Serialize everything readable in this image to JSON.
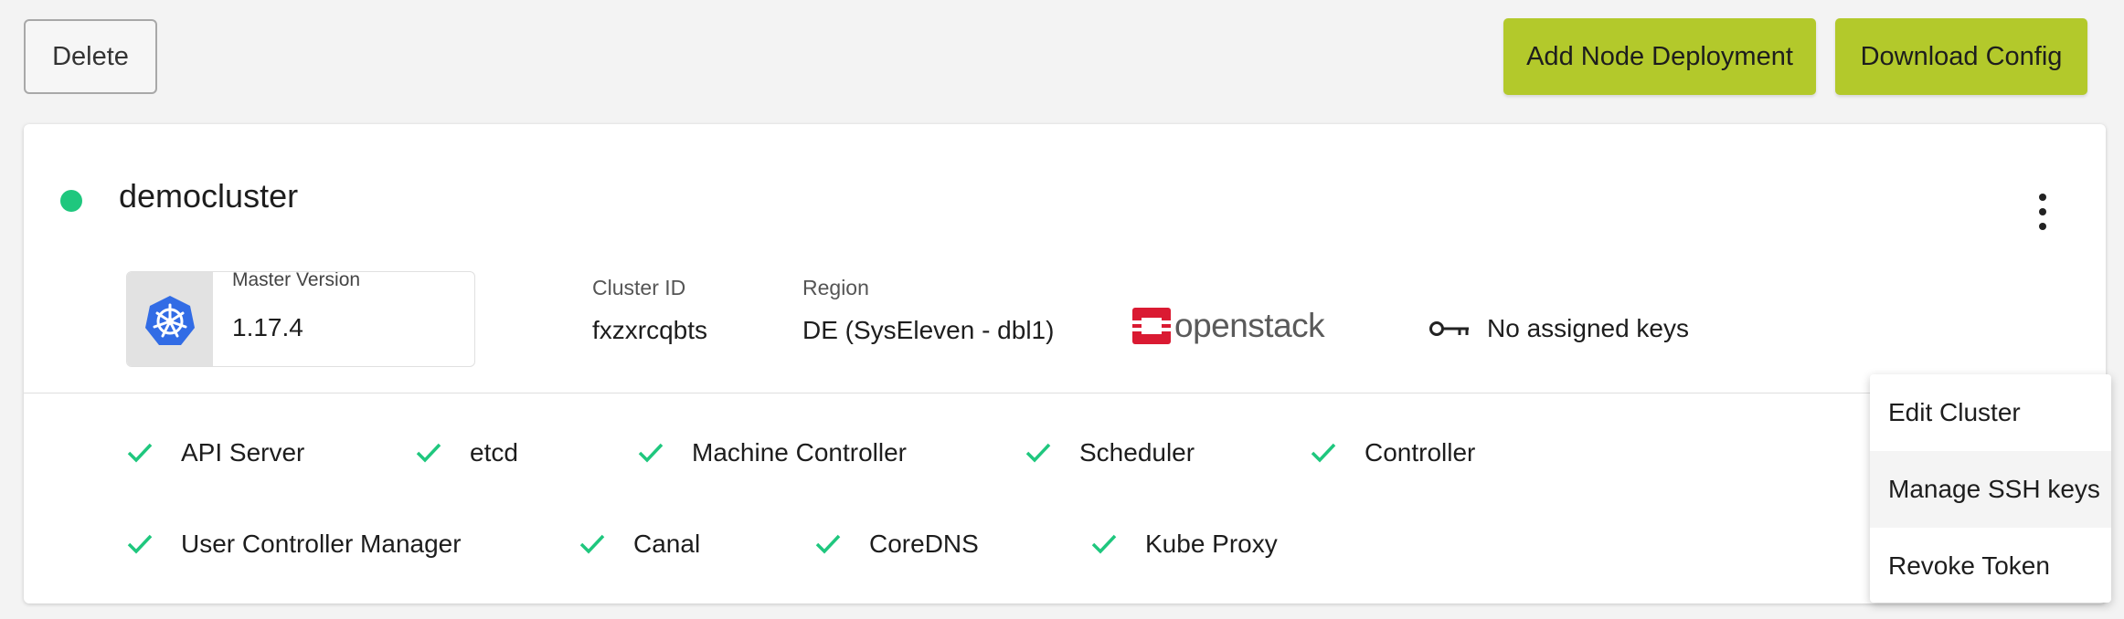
{
  "toolbar": {
    "delete_label": "Delete",
    "add_node_label": "Add Node Deployment",
    "download_label": "Download Config",
    "accent_color": "#b3c92b"
  },
  "cluster": {
    "name": "democluster",
    "status_color": "#1fc77e",
    "master_version_label": "Master Version",
    "master_version": "1.17.4",
    "cluster_id_label": "Cluster ID",
    "cluster_id": "fxzxrcqbts",
    "region_label": "Region",
    "region": "DE (SysEleven - dbl1)",
    "provider": "openstack",
    "provider_color": "#da1a32",
    "keys_text": "No assigned keys"
  },
  "health": [
    {
      "label": "API Server"
    },
    {
      "label": "etcd"
    },
    {
      "label": "Machine Controller"
    },
    {
      "label": "Scheduler"
    },
    {
      "label": "Controller"
    },
    {
      "label": "User Controller Manager"
    },
    {
      "label": "Canal"
    },
    {
      "label": "CoreDNS"
    },
    {
      "label": "Kube Proxy"
    }
  ],
  "menu": {
    "items": [
      {
        "label": "Edit Cluster"
      },
      {
        "label": "Manage SSH keys"
      },
      {
        "label": "Revoke Token"
      }
    ]
  }
}
